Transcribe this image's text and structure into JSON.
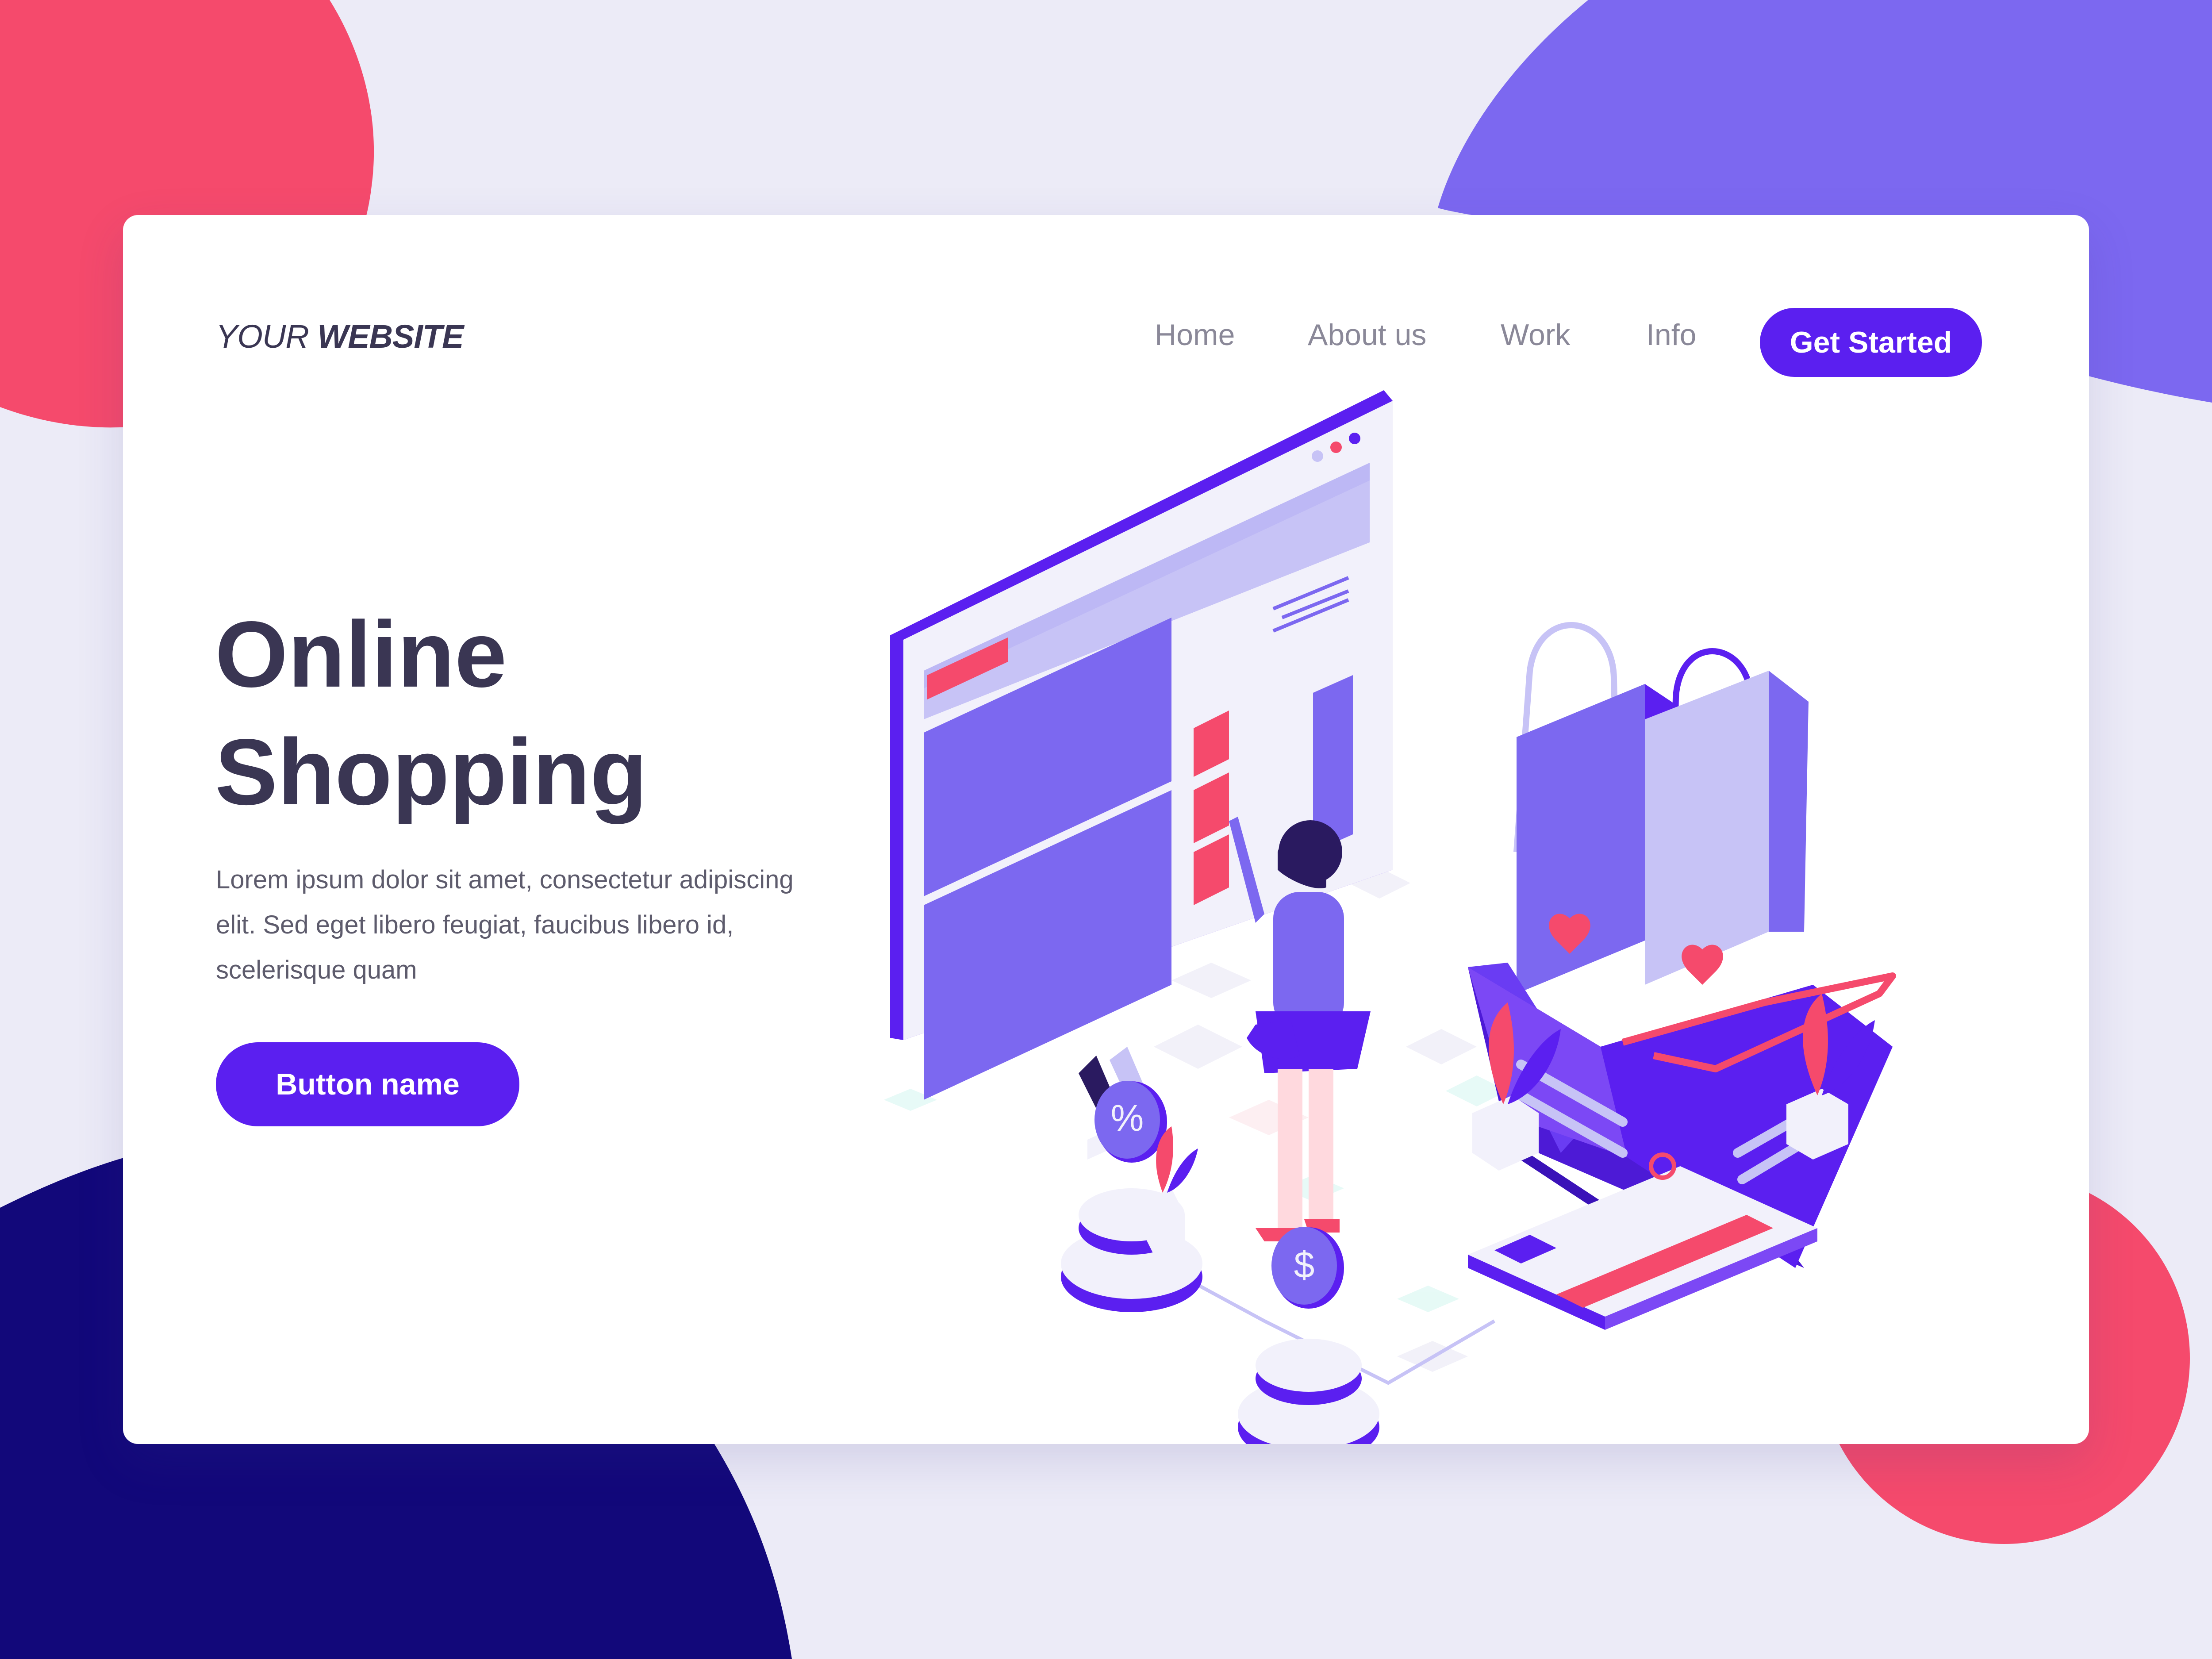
{
  "brand": {
    "logo_light": "YOUR ",
    "logo_bold": "WEBSITE"
  },
  "nav": {
    "items": [
      "Home",
      "About us",
      "Work",
      "Info"
    ],
    "cta_label": "Get Started"
  },
  "hero": {
    "title_line1": "Online",
    "title_line2": "Shopping",
    "description": "Lorem ipsum dolor sit amet, consectetur adipiscing elit. Sed eget libero feugiat, faucibus libero id, scelerisque quam",
    "button_label": "Button name"
  },
  "illustration": {
    "percent_symbol": "%",
    "dollar_symbol": "$"
  },
  "colors": {
    "primary": "#5b1ff0",
    "accent_red": "#f54a6c",
    "light_purple": "#c7c3f6",
    "mid_purple": "#7c68f0",
    "dark_navy": "#12087a",
    "background": "#ecebf7"
  },
  "icons": [
    "handbag-icon",
    "high-heels-icon",
    "heart-icon",
    "percent-icon",
    "dollar-icon",
    "credit-card-icon",
    "shopping-basket-icon",
    "plant-icon"
  ]
}
